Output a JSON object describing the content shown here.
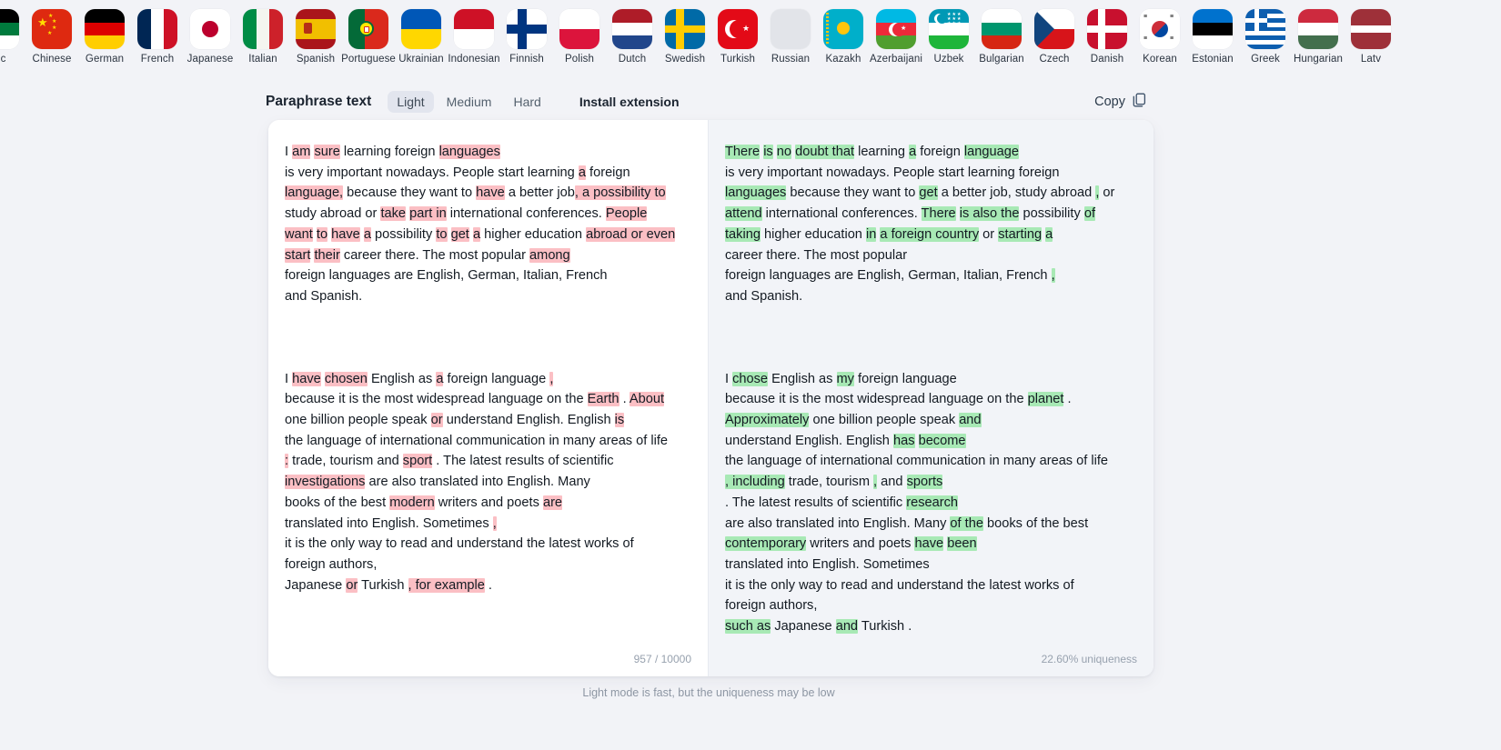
{
  "languages": [
    {
      "name": "Arabic",
      "label": "bic",
      "flag": "arabic"
    },
    {
      "name": "Chinese",
      "label": "Chinese",
      "flag": "chinese"
    },
    {
      "name": "German",
      "label": "German",
      "flag": "german"
    },
    {
      "name": "French",
      "label": "French",
      "flag": "french"
    },
    {
      "name": "Japanese",
      "label": "Japanese",
      "flag": "japanese"
    },
    {
      "name": "Italian",
      "label": "Italian",
      "flag": "italian"
    },
    {
      "name": "Spanish",
      "label": "Spanish",
      "flag": "spanish"
    },
    {
      "name": "Portuguese",
      "label": "Portuguese",
      "flag": "portuguese"
    },
    {
      "name": "Ukrainian",
      "label": "Ukrainian",
      "flag": "ukrainian"
    },
    {
      "name": "Indonesian",
      "label": "Indonesian",
      "flag": "indonesian"
    },
    {
      "name": "Finnish",
      "label": "Finnish",
      "flag": "finnish"
    },
    {
      "name": "Polish",
      "label": "Polish",
      "flag": "polish"
    },
    {
      "name": "Dutch",
      "label": "Dutch",
      "flag": "dutch"
    },
    {
      "name": "Swedish",
      "label": "Swedish",
      "flag": "swedish"
    },
    {
      "name": "Turkish",
      "label": "Turkish",
      "flag": "turkish"
    },
    {
      "name": "Russian",
      "label": "Russian",
      "flag": "russian"
    },
    {
      "name": "Kazakh",
      "label": "Kazakh",
      "flag": "kazakh"
    },
    {
      "name": "Azerbaijani",
      "label": "Azerbaijani",
      "flag": "azerbaijani"
    },
    {
      "name": "Uzbek",
      "label": "Uzbek",
      "flag": "uzbek"
    },
    {
      "name": "Bulgarian",
      "label": "Bulgarian",
      "flag": "bulgarian"
    },
    {
      "name": "Czech",
      "label": "Czech",
      "flag": "czech"
    },
    {
      "name": "Danish",
      "label": "Danish",
      "flag": "danish"
    },
    {
      "name": "Korean",
      "label": "Korean",
      "flag": "korean"
    },
    {
      "name": "Estonian",
      "label": "Estonian",
      "flag": "estonian"
    },
    {
      "name": "Greek",
      "label": "Greek",
      "flag": "greek"
    },
    {
      "name": "Hungarian",
      "label": "Hungarian",
      "flag": "hungarian"
    },
    {
      "name": "Latvian",
      "label": "Latv",
      "flag": "latvian"
    }
  ],
  "toolbar": {
    "title": "Paraphrase text",
    "modes": [
      {
        "label": "Light",
        "active": true
      },
      {
        "label": "Medium",
        "active": false
      },
      {
        "label": "Hard",
        "active": false
      }
    ],
    "install_label": "Install extension",
    "copy_label": "Copy",
    "copy_icon": "clipboard-icon"
  },
  "panes": {
    "left": {
      "highlight_color": "#fbbfc4",
      "char_count": "957 / 10000",
      "paragraphs": [
        [
          {
            "t": "I ",
            "h": false
          },
          {
            "t": "am",
            "h": true
          },
          {
            "t": " ",
            "h": false
          },
          {
            "t": "sure",
            "h": true
          },
          {
            "t": " learning foreign ",
            "h": false
          },
          {
            "t": "languages",
            "h": true
          },
          {
            "t": "\nis very important nowadays. People start learning ",
            "h": false
          },
          {
            "t": "a",
            "h": true
          },
          {
            "t": " foreign\n",
            "h": false
          },
          {
            "t": "language,",
            "h": true
          },
          {
            "t": " because they want to ",
            "h": false
          },
          {
            "t": "have",
            "h": true
          },
          {
            "t": " a better job",
            "h": false
          },
          {
            "t": ", a possibility to",
            "h": true
          },
          {
            "t": "\nstudy abroad or ",
            "h": false
          },
          {
            "t": "take",
            "h": true
          },
          {
            "t": " ",
            "h": false
          },
          {
            "t": "part in",
            "h": true
          },
          {
            "t": " international conferences. ",
            "h": false
          },
          {
            "t": "People",
            "h": true
          },
          {
            "t": "\n",
            "h": false
          },
          {
            "t": "want",
            "h": true
          },
          {
            "t": " ",
            "h": false
          },
          {
            "t": "to",
            "h": true
          },
          {
            "t": " ",
            "h": false
          },
          {
            "t": "have",
            "h": true
          },
          {
            "t": " ",
            "h": false
          },
          {
            "t": "a",
            "h": true
          },
          {
            "t": " possibility ",
            "h": false
          },
          {
            "t": "to",
            "h": true
          },
          {
            "t": " ",
            "h": false
          },
          {
            "t": "get",
            "h": true
          },
          {
            "t": " ",
            "h": false
          },
          {
            "t": "a",
            "h": true
          },
          {
            "t": " higher education ",
            "h": false
          },
          {
            "t": "abroad or even",
            "h": true
          },
          {
            "t": "\n",
            "h": false
          },
          {
            "t": "start",
            "h": true
          },
          {
            "t": " ",
            "h": false
          },
          {
            "t": "their",
            "h": true
          },
          {
            "t": " career there. The most popular ",
            "h": false
          },
          {
            "t": "among",
            "h": true
          },
          {
            "t": "\nforeign languages are English, German, Italian, French\nand Spanish.",
            "h": false
          }
        ],
        [
          {
            "t": "I ",
            "h": false
          },
          {
            "t": "have",
            "h": true
          },
          {
            "t": " ",
            "h": false
          },
          {
            "t": "chosen",
            "h": true
          },
          {
            "t": " English as ",
            "h": false
          },
          {
            "t": "a",
            "h": true
          },
          {
            "t": " foreign language ",
            "h": false
          },
          {
            "t": ",",
            "h": true
          },
          {
            "t": "\nbecause it is the most widespread language on the ",
            "h": false
          },
          {
            "t": "Earth",
            "h": true
          },
          {
            "t": " . ",
            "h": false
          },
          {
            "t": "About",
            "h": true
          },
          {
            "t": "\none billion people speak ",
            "h": false
          },
          {
            "t": "or",
            "h": true
          },
          {
            "t": " understand English. English ",
            "h": false
          },
          {
            "t": "is",
            "h": true
          },
          {
            "t": "\nthe language of international communication in many areas of life\n",
            "h": false
          },
          {
            "t": ":",
            "h": true
          },
          {
            "t": " trade, tourism and ",
            "h": false
          },
          {
            "t": "sport",
            "h": true
          },
          {
            "t": " . The latest results of scientific\n",
            "h": false
          },
          {
            "t": "investigations",
            "h": true
          },
          {
            "t": " are also translated into English. Many\nbooks of the best ",
            "h": false
          },
          {
            "t": "modern",
            "h": true
          },
          {
            "t": " writers and poets ",
            "h": false
          },
          {
            "t": "are",
            "h": true
          },
          {
            "t": "\ntranslated into English. Sometimes ",
            "h": false
          },
          {
            "t": ",",
            "h": true
          },
          {
            "t": "\nit is the only way to read and understand the latest works of\nforeign authors,\nJapanese ",
            "h": false
          },
          {
            "t": "or",
            "h": true
          },
          {
            "t": " Turkish ",
            "h": false
          },
          {
            "t": ", for example",
            "h": true
          },
          {
            "t": " .",
            "h": false
          }
        ]
      ]
    },
    "right": {
      "highlight_color": "#a8e9b5",
      "uniqueness": "22.60% uniqueness",
      "paragraphs": [
        [
          {
            "t": "There",
            "h": true
          },
          {
            "t": " ",
            "h": false
          },
          {
            "t": "is",
            "h": true
          },
          {
            "t": " ",
            "h": false
          },
          {
            "t": "no",
            "h": true
          },
          {
            "t": " ",
            "h": false
          },
          {
            "t": "doubt that",
            "h": true
          },
          {
            "t": " learning ",
            "h": false
          },
          {
            "t": "a",
            "h": true
          },
          {
            "t": " foreign ",
            "h": false
          },
          {
            "t": "language",
            "h": true
          },
          {
            "t": "\nis very important nowadays. People start learning foreign\n",
            "h": false
          },
          {
            "t": "languages",
            "h": true
          },
          {
            "t": " because they want to ",
            "h": false
          },
          {
            "t": "get",
            "h": true
          },
          {
            "t": " a better job, study abroad ",
            "h": false
          },
          {
            "t": ",",
            "h": true
          },
          {
            "t": " or\n",
            "h": false
          },
          {
            "t": "attend",
            "h": true
          },
          {
            "t": " international conferences. ",
            "h": false
          },
          {
            "t": "There",
            "h": true
          },
          {
            "t": " ",
            "h": false
          },
          {
            "t": "is also the",
            "h": true
          },
          {
            "t": " possibility ",
            "h": false
          },
          {
            "t": "of",
            "h": true
          },
          {
            "t": "\n",
            "h": false
          },
          {
            "t": "taking",
            "h": true
          },
          {
            "t": " higher education ",
            "h": false
          },
          {
            "t": "in",
            "h": true
          },
          {
            "t": " ",
            "h": false
          },
          {
            "t": "a foreign country",
            "h": true
          },
          {
            "t": " or ",
            "h": false
          },
          {
            "t": "starting",
            "h": true
          },
          {
            "t": " ",
            "h": false
          },
          {
            "t": "a",
            "h": true
          },
          {
            "t": "\ncareer there. The most popular\nforeign languages are English, German, Italian, French ",
            "h": false
          },
          {
            "t": ",",
            "h": true
          },
          {
            "t": "\nand Spanish.",
            "h": false
          }
        ],
        [
          {
            "t": "I ",
            "h": false
          },
          {
            "t": "chose",
            "h": true
          },
          {
            "t": " English as ",
            "h": false
          },
          {
            "t": "my",
            "h": true
          },
          {
            "t": " foreign language\nbecause it is the most widespread language on the ",
            "h": false
          },
          {
            "t": "planet",
            "h": true
          },
          {
            "t": " .\n",
            "h": false
          },
          {
            "t": "Approximately",
            "h": true
          },
          {
            "t": " one billion people speak ",
            "h": false
          },
          {
            "t": "and",
            "h": true
          },
          {
            "t": "\nunderstand English. English ",
            "h": false
          },
          {
            "t": "has",
            "h": true
          },
          {
            "t": " ",
            "h": false
          },
          {
            "t": "become",
            "h": true
          },
          {
            "t": "\nthe language of international communication in many areas of life\n",
            "h": false
          },
          {
            "t": ", including",
            "h": true
          },
          {
            "t": " trade, tourism ",
            "h": false
          },
          {
            "t": ",",
            "h": true
          },
          {
            "t": " and ",
            "h": false
          },
          {
            "t": "sports",
            "h": true
          },
          {
            "t": "\n. The latest results of scientific ",
            "h": false
          },
          {
            "t": "research",
            "h": true
          },
          {
            "t": "\nare also translated into English. Many ",
            "h": false
          },
          {
            "t": "of the",
            "h": true
          },
          {
            "t": " books of the best\n",
            "h": false
          },
          {
            "t": "contemporary",
            "h": true
          },
          {
            "t": " writers and poets ",
            "h": false
          },
          {
            "t": "have",
            "h": true
          },
          {
            "t": " ",
            "h": false
          },
          {
            "t": "been",
            "h": true
          },
          {
            "t": "\ntranslated into English. Sometimes\nit is the only way to read and understand the latest works of\nforeign authors,\n",
            "h": false
          },
          {
            "t": "such as",
            "h": true
          },
          {
            "t": " Japanese ",
            "h": false
          },
          {
            "t": "and",
            "h": true
          },
          {
            "t": " Turkish .",
            "h": false
          }
        ]
      ]
    }
  },
  "hint": "Light mode is fast, but the uniqueness may be low"
}
